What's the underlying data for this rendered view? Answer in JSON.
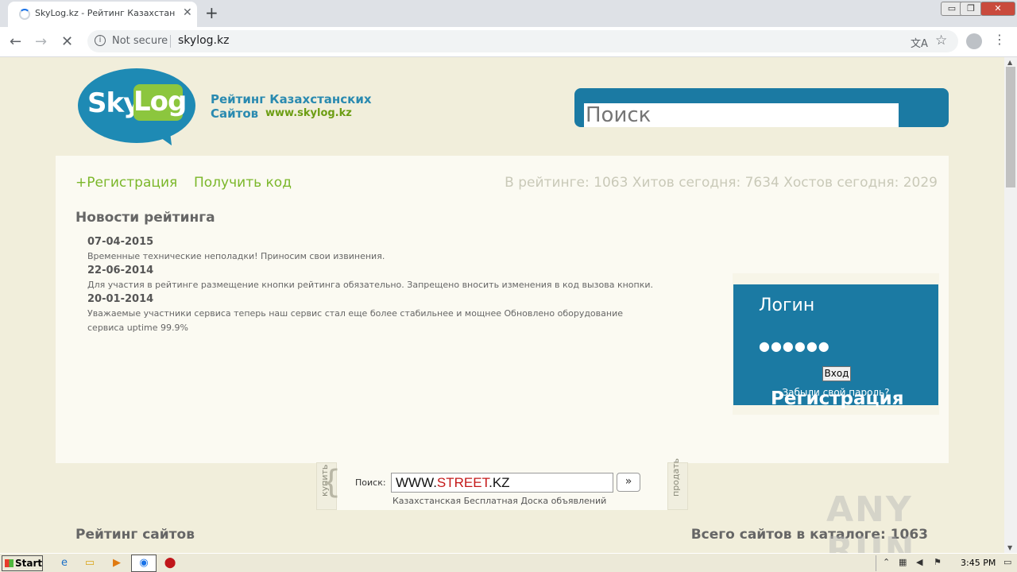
{
  "browser": {
    "tab_title": "SkyLog.kz - Рейтинг Казахстански",
    "tab_close": "✕",
    "new_tab": "+",
    "window_controls": [
      "▭",
      "❐",
      "✕"
    ],
    "security": "Not secure",
    "url": "skylog.kz"
  },
  "header": {
    "logo_sky": "Sky",
    "logo_log": "Log",
    "tagline": "Рейтинг Казахстанских Сайтов",
    "site_url": "www.skylog.kz",
    "search_placeholder": "Поиск"
  },
  "top_links": {
    "register": "+Регистрация",
    "get_code": "Получить код"
  },
  "stats_text": "В рейтинге: 1063 Хитов сегодня: 7634 Хостов сегодня: 2029",
  "news": {
    "heading": "Новости рейтинга",
    "items": [
      {
        "date": "07-04-2015",
        "text": "Временные технические неполадки! Приносим свои извинения."
      },
      {
        "date": "22-06-2014",
        "text": "Для участия в рейтинге размещение кнопки рейтинга обязательно. Запрещено вносить изменения в код вызова кнопки."
      },
      {
        "date": "20-01-2014",
        "text": "Уважаемые участники сервиса теперь наш сервис стал еще более стабильнее и мощнее Обновлено оборудование сервиса uptime 99.9%"
      }
    ]
  },
  "login": {
    "title": "Логин",
    "password_mask": "●●●●●●",
    "button": "Вход",
    "forgot": "Забыли свой пароль?",
    "register": "Регистрация"
  },
  "street": {
    "buy": "купить",
    "sell": "продать",
    "label": "Поиск:",
    "value_prefix": "WWW.",
    "value_red": "STREET",
    "value_suffix": ".KZ",
    "go": "»",
    "subtitle": "Казахстанская Бесплатная Доска объявлений"
  },
  "footer": {
    "rating_heading": "Рейтинг сайтов",
    "catalog_total": "Всего сайтов в каталоге: 1063"
  },
  "watermark": "ANY RUN",
  "taskbar": {
    "start": "Start",
    "clock": "3:45 PM"
  }
}
